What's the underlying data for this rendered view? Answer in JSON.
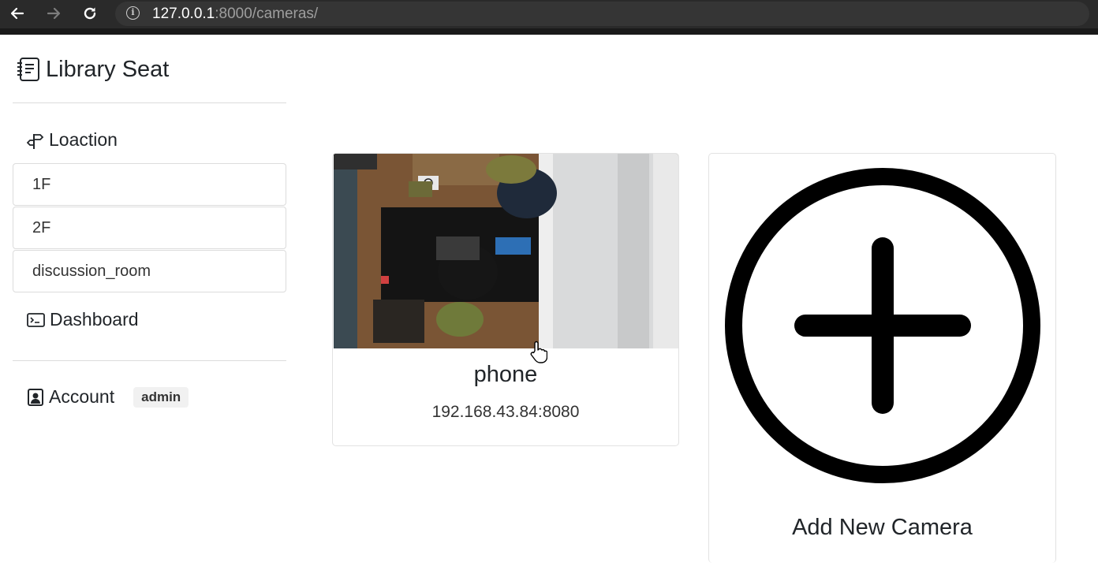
{
  "browser": {
    "back_icon": "arrow-left-icon",
    "forward_icon": "arrow-right-icon",
    "reload_icon": "reload-icon",
    "url_host": "127.0.0.1",
    "url_rest": ":8000/cameras/"
  },
  "sidebar": {
    "brand": "Library Seat",
    "location_heading": "Loaction",
    "locations": [
      "1F",
      "2F",
      "discussion_room"
    ],
    "dashboard": "Dashboard",
    "account": "Account",
    "account_badge": "admin"
  },
  "cameras": [
    {
      "name": "phone",
      "address": "192.168.43.84:8080"
    }
  ],
  "add_camera": {
    "label": "Add New Camera"
  }
}
